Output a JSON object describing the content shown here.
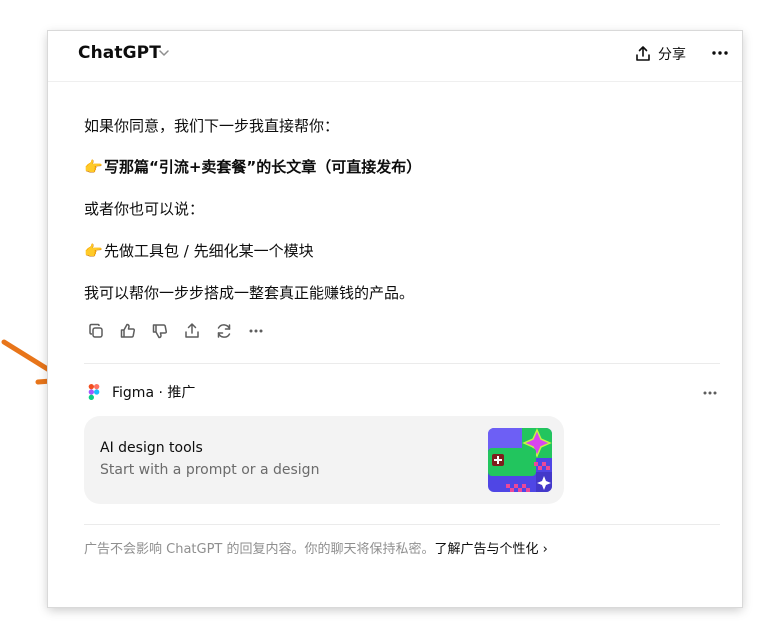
{
  "header": {
    "model_name": "ChatGPT",
    "share_label": "分享"
  },
  "message": {
    "line1": "如果你同意，我们下一步我直接帮你：",
    "line2_emoji": "👉",
    "line2": "写那篇“引流+卖套餐”的长文章（可直接发布）",
    "line3": "或者你也可以说：",
    "line4_emoji": "👉",
    "line4": "先做工具包 / 先细化某一个模块",
    "line5": "我可以帮你一步步搭成一整套真正能赚钱的产品。"
  },
  "ad": {
    "brand": "Figma · 推广",
    "title": "AI design tools",
    "subtitle": "Start with a prompt or a design"
  },
  "footer": {
    "notice": "广告不会影响 ChatGPT 的回复内容。你的聊天将保持私密。",
    "learn_more": "了解广告与个性化 ›"
  },
  "colors": {
    "accent_arrow": "#e8751a",
    "text": "#0d0d0d",
    "muted": "#8f8f8f",
    "card_bg": "#f3f3f3"
  },
  "icons": [
    "chevron-down-icon",
    "share-icon",
    "more-icon",
    "copy-icon",
    "thumbs-up-icon",
    "thumbs-down-icon",
    "share-icon",
    "regenerate-icon",
    "figma-logo-icon"
  ]
}
